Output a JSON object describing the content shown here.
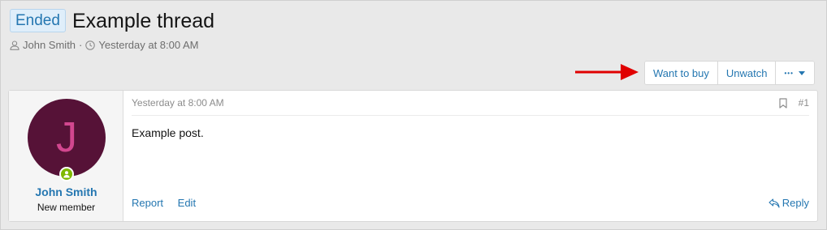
{
  "thread": {
    "prefix": "Ended",
    "title": "Example thread",
    "author": "John Smith",
    "separator": "·",
    "date": "Yesterday at 8:00 AM"
  },
  "buttons": {
    "want_to_buy": "Want to buy",
    "unwatch": "Unwatch",
    "more": "•••"
  },
  "post": {
    "avatar_letter": "J",
    "username": "John Smith",
    "user_title": "New member",
    "date": "Yesterday at 8:00 AM",
    "number": "#1",
    "body": "Example post.",
    "actions": {
      "report": "Report",
      "edit": "Edit",
      "reply": "Reply"
    }
  },
  "colors": {
    "link": "#2577b1",
    "avatar_bg": "#561237",
    "avatar_letter": "#d2478f",
    "online": "#7fb900",
    "annotation_arrow": "#e00000"
  },
  "icons": [
    "user-icon",
    "clock-icon",
    "caret-down-icon",
    "bookmark-icon",
    "reply-icon",
    "online-status-icon",
    "annotation-arrow"
  ]
}
